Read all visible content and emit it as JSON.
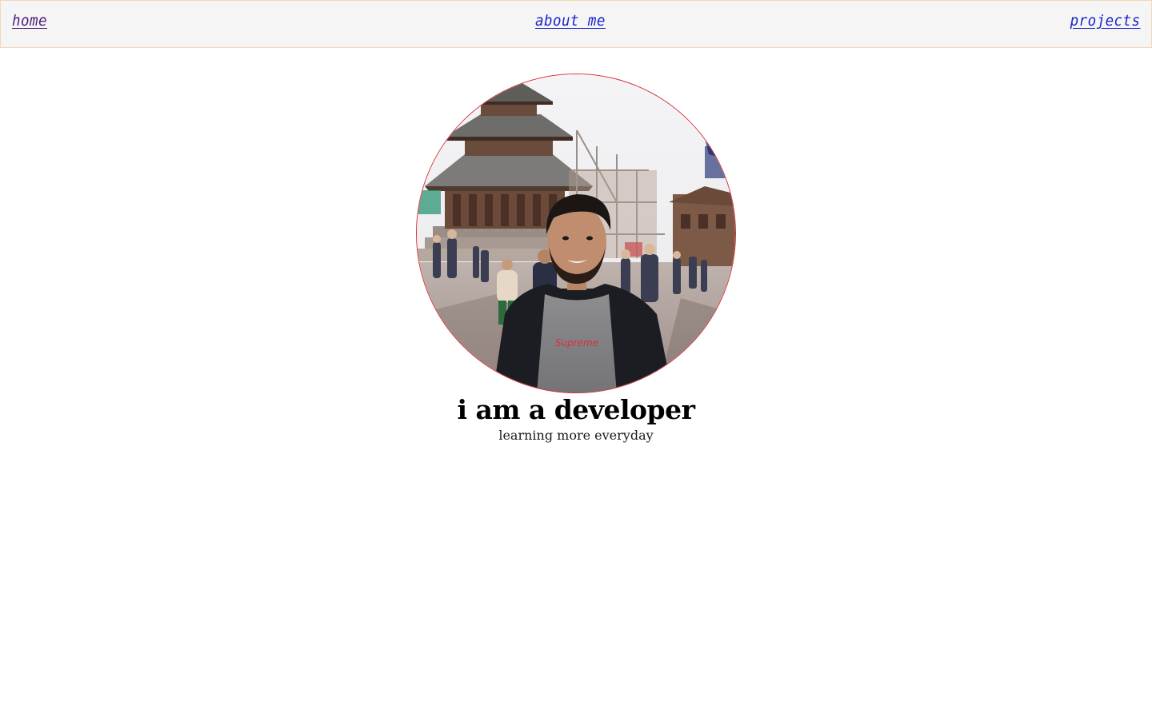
{
  "nav": {
    "home": "home",
    "about": "about me",
    "projects": "projects"
  },
  "hero": {
    "headline": "i am a developer",
    "subline": "learning more everyday",
    "shirt_text": "Supreme"
  },
  "colors": {
    "nav_background": "#f5f5f5",
    "nav_border": "#f0d9b5",
    "visited_link": "#4b1b78",
    "link": "#1a23c9",
    "photo_border": "#d4313a"
  },
  "icons": {
    "profile_photo": "profile-photo-image"
  }
}
